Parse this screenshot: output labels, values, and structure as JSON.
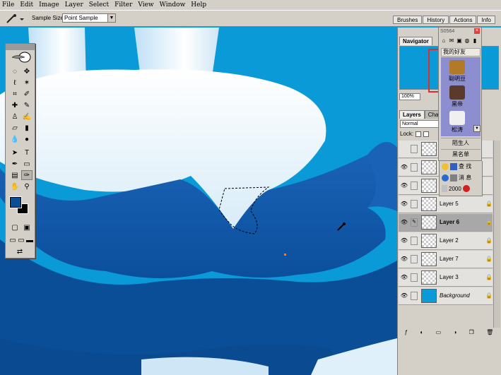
{
  "menu": [
    "File",
    "Edit",
    "Image",
    "Layer",
    "Select",
    "Filter",
    "View",
    "Window",
    "Help"
  ],
  "options": {
    "sample_size_label": "Sample Size:",
    "sample_size_value": "Point Sample"
  },
  "palette_well": [
    "Brushes",
    "History",
    "Actions",
    "Info"
  ],
  "navigator": {
    "tabs": [
      "Navigator"
    ],
    "zoom": "100%"
  },
  "layers_panel": {
    "tabs": [
      "Layers",
      "Cha"
    ],
    "blend_mode": "Normal",
    "lock_label": "Lock:",
    "layers": [
      {
        "name": "",
        "visible": false
      },
      {
        "name": "",
        "visible": true
      },
      {
        "name": "",
        "visible": true
      },
      {
        "name": "Layer 5",
        "visible": true
      },
      {
        "name": "Layer 6",
        "visible": true,
        "active": true
      },
      {
        "name": "Layer 2",
        "visible": true
      },
      {
        "name": "Layer 7",
        "visible": true
      },
      {
        "name": "Layer 3",
        "visible": true
      },
      {
        "name": "Background",
        "visible": true
      }
    ]
  },
  "qq": {
    "title": "S0564",
    "group": "我的好友",
    "users": [
      "聪明豆",
      "黑帝",
      "松涛"
    ],
    "strangers": "陌生人",
    "blacklist": "黑名单",
    "find": "查 找",
    "messages": "消 息",
    "bottom": "2000"
  },
  "colors": {
    "foreground": "#0a4f96",
    "background": "#000000",
    "sky": "#0a9ad8"
  }
}
